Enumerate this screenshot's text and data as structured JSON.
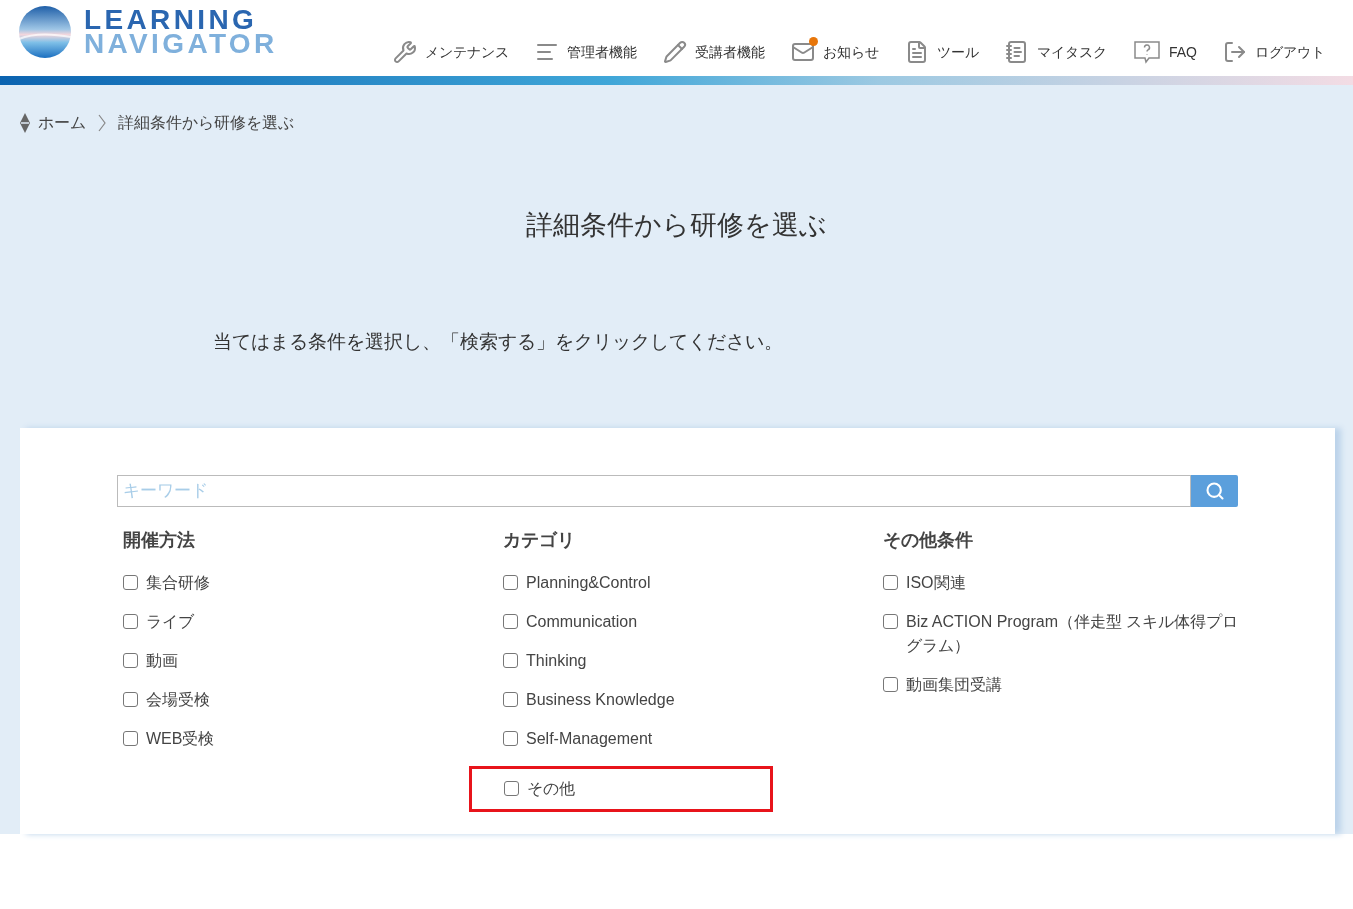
{
  "logo": {
    "line_1": "LEARNING",
    "line_2": "NAVIGATOR"
  },
  "nav": [
    {
      "kind": "wrench",
      "label": "メンテナンス",
      "notification": false
    },
    {
      "kind": "admin",
      "label": "管理者機能",
      "notification": false
    },
    {
      "kind": "pencil",
      "label": "受講者機能",
      "notification": false
    },
    {
      "kind": "mail",
      "label": "お知らせ",
      "notification": true
    },
    {
      "kind": "document",
      "label": "ツール",
      "notification": false
    },
    {
      "kind": "notepad",
      "label": "マイタスク",
      "notification": false
    },
    {
      "kind": "faq",
      "label": "FAQ",
      "notification": false
    },
    {
      "kind": "logout",
      "label": "ログアウト",
      "notification": false
    }
  ],
  "breadcrumb": [
    "ホーム",
    "詳細条件から研修を選ぶ"
  ],
  "page_title": "詳細条件から研修を選ぶ",
  "instruction": "当てはまる条件を選択し、「検索する」をクリックしてください。",
  "search": {
    "placeholder": "キーワード"
  },
  "filter_groups": [
    {
      "heading": "開催方法",
      "options": [
        {
          "label": "集合研修",
          "checked": false,
          "highlighted": false
        },
        {
          "label": "ライブ",
          "checked": false,
          "highlighted": false
        },
        {
          "label": "動画",
          "checked": false,
          "highlighted": false
        },
        {
          "label": "会場受検",
          "checked": false,
          "highlighted": false
        },
        {
          "label": "WEB受検",
          "checked": false,
          "highlighted": false
        }
      ]
    },
    {
      "heading": "カテゴリ",
      "options": [
        {
          "label": "Planning&Control",
          "checked": false,
          "highlighted": false
        },
        {
          "label": "Communication",
          "checked": false,
          "highlighted": false
        },
        {
          "label": "Thinking",
          "checked": false,
          "highlighted": false
        },
        {
          "label": "Business Knowledge",
          "checked": false,
          "highlighted": false
        },
        {
          "label": "Self-Management",
          "checked": false,
          "highlighted": false
        },
        {
          "label": "その他",
          "checked": false,
          "highlighted": true
        }
      ]
    },
    {
      "heading": "その他条件",
      "options": [
        {
          "label": "ISO関連",
          "checked": false,
          "highlighted": false
        },
        {
          "label": "Biz ACTION Program（伴走型 スキル体得プログラム）",
          "checked": false,
          "highlighted": false
        },
        {
          "label": "動画集団受講",
          "checked": false,
          "highlighted": false
        }
      ]
    }
  ]
}
